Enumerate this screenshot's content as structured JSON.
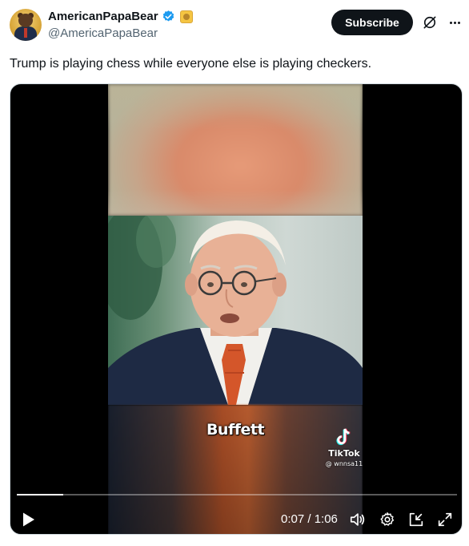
{
  "tweet": {
    "author": {
      "display_name": "AmericanPapaBear",
      "handle": "@AmericaPapaBear",
      "verified_color": "#1d9bf0"
    },
    "subscribe_label": "Subscribe",
    "text": "Trump is playing chess while everyone else is playing checkers."
  },
  "video": {
    "caption": "Buffett",
    "watermark": {
      "brand": "TikTok",
      "user": "@ wnnsa11"
    },
    "progress_fraction": 0.106,
    "time_text": "0:07 / 1:06",
    "controls": {
      "play_icon": "play-icon",
      "volume_icon": "volume-icon",
      "settings_icon": "gear-icon",
      "pip_icon": "picture-in-picture-icon",
      "fullscreen_icon": "expand-icon"
    }
  },
  "header_icons": {
    "grok": "grok-icon",
    "more": "more-icon"
  }
}
